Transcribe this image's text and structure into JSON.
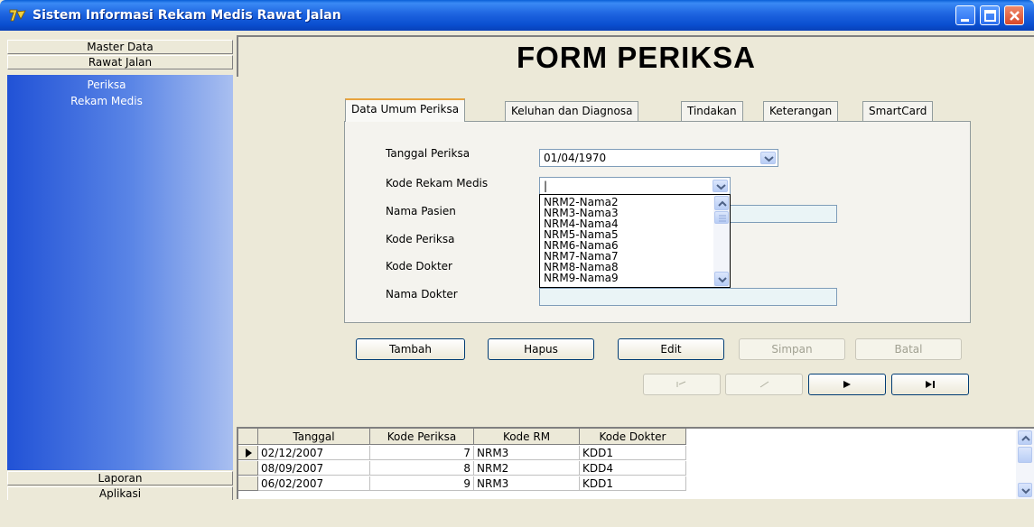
{
  "window": {
    "title": "Sistem Informasi Rekam Medis Rawat Jalan"
  },
  "sidebar": {
    "top_groups": [
      "Master Data",
      "Rawat Jalan"
    ],
    "items": [
      "Periksa",
      "Rekam Medis"
    ],
    "bottom_groups": [
      "Laporan",
      "Aplikasi"
    ]
  },
  "header": {
    "title": "FORM PERIKSA"
  },
  "tabs": [
    "Data Umum Periksa",
    "Keluhan dan Diagnosa",
    "Tindakan",
    "Keterangan",
    "SmartCard"
  ],
  "form": {
    "labels": {
      "tanggal": "Tanggal Periksa",
      "kode_rm": "Kode Rekam Medis",
      "nama_pasien": "Nama Pasien",
      "kode_periksa": "Kode Periksa",
      "kode_dokter": "Kode Dokter",
      "nama_dokter": "Nama Dokter"
    },
    "values": {
      "tanggal": "01/04/1970",
      "kode_rm": "|"
    },
    "kode_rm_options": [
      "NRM2-Nama2",
      "NRM3-Nama3",
      "NRM4-Nama4",
      "NRM5-Nama5",
      "NRM6-Nama6",
      "NRM7-Nama7",
      "NRM8-Nama8",
      "NRM9-Nama9"
    ]
  },
  "buttons": {
    "tambah": "Tambah",
    "hapus": "Hapus",
    "edit": "Edit",
    "simpan": "Simpan",
    "batal": "Batal"
  },
  "grid": {
    "headers": [
      "Tanggal",
      "Kode Periksa",
      "Kode RM",
      "Kode Dokter"
    ],
    "rows": [
      [
        "02/12/2007",
        "7",
        "NRM3",
        "KDD1"
      ],
      [
        "08/09/2007",
        "8",
        "NRM2",
        "KDD4"
      ],
      [
        "06/02/2007",
        "9",
        "NRM3",
        "KDD1"
      ]
    ]
  },
  "colors": {
    "titlebar": "#0a4fd0",
    "sidebar_blue": "#2152d6",
    "tab_accent": "#e8a33d"
  }
}
